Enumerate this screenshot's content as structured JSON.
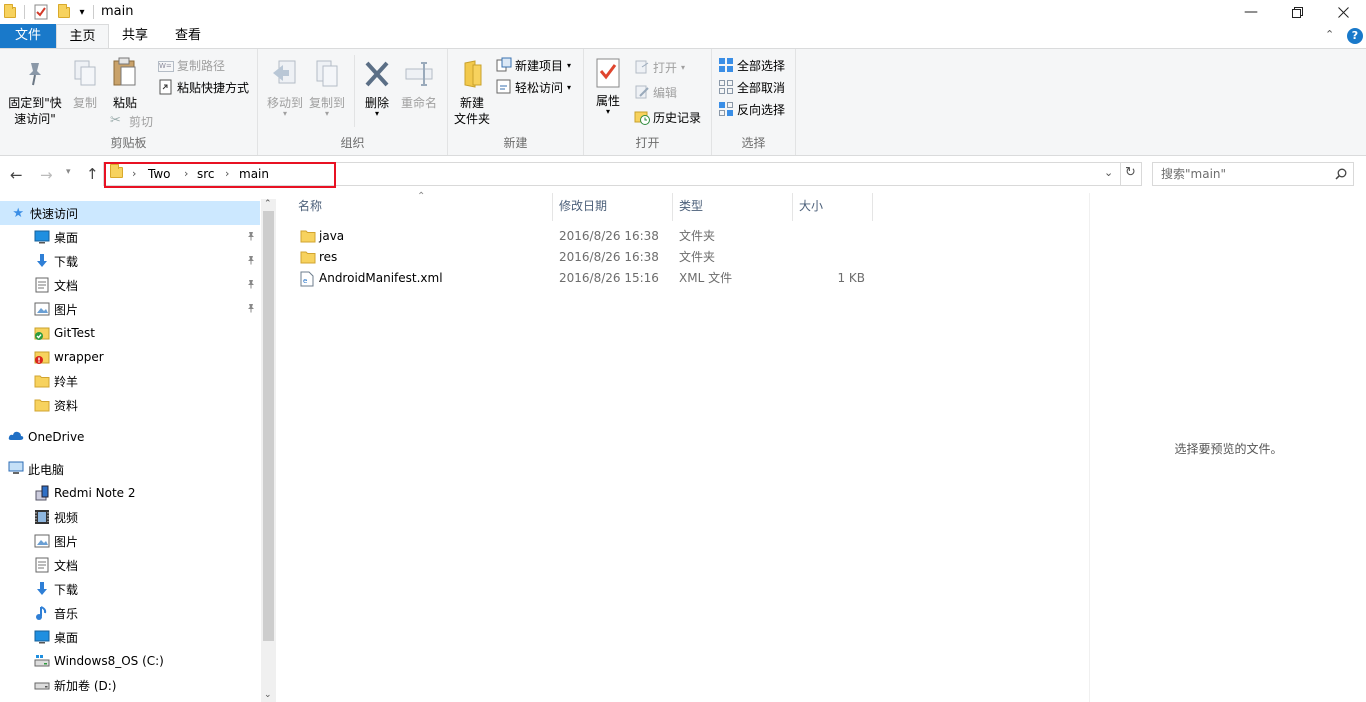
{
  "window": {
    "title": "main",
    "minimize_icon": "minimize-icon",
    "maximize_icon": "restore-icon",
    "close_icon": "close-icon"
  },
  "tabs": [
    "文件",
    "主页",
    "共享",
    "查看"
  ],
  "ribbon": {
    "clipboard": {
      "label": "剪贴板",
      "pin_quick_access": "固定到\"快速访问\"",
      "pin_line1": "固定到\"快",
      "pin_line2": "速访问\"",
      "copy": "复制",
      "paste": "粘贴",
      "copy_path": "复制路径",
      "paste_shortcut": "粘贴快捷方式",
      "cut": "剪切"
    },
    "organize": {
      "label": "组织",
      "move_to": "移动到",
      "copy_to": "复制到",
      "delete": "删除",
      "rename": "重命名"
    },
    "new": {
      "label": "新建",
      "new_folder_1": "新建",
      "new_folder_2": "文件夹",
      "new_item": "新建项目",
      "easy_access": "轻松访问"
    },
    "open": {
      "label": "打开",
      "properties": "属性",
      "open": "打开",
      "edit": "编辑",
      "history": "历史记录"
    },
    "select": {
      "label": "选择",
      "select_all": "全部选择",
      "select_none": "全部取消",
      "invert": "反向选择"
    }
  },
  "breadcrumb": [
    "Two",
    "src",
    "main"
  ],
  "search_placeholder": "搜索\"main\"",
  "sidebar": {
    "quick_access": "快速访问",
    "quick_items": [
      {
        "label": "桌面",
        "icon": "desktop-icon",
        "pinned": true
      },
      {
        "label": "下载",
        "icon": "download-icon",
        "pinned": true
      },
      {
        "label": "文档",
        "icon": "documents-icon",
        "pinned": true
      },
      {
        "label": "图片",
        "icon": "pictures-icon",
        "pinned": true
      },
      {
        "label": "GitTest",
        "icon": "git-folder-icon",
        "pinned": false
      },
      {
        "label": "wrapper",
        "icon": "git-conflict-folder-icon",
        "pinned": false
      },
      {
        "label": "羚羊",
        "icon": "folder-icon",
        "pinned": false
      },
      {
        "label": "资料",
        "icon": "folder-icon",
        "pinned": false
      }
    ],
    "onedrive": "OneDrive",
    "this_pc": "此电脑",
    "pc_items": [
      {
        "label": "Redmi Note 2",
        "icon": "phone-icon"
      },
      {
        "label": "视频",
        "icon": "videos-icon"
      },
      {
        "label": "图片",
        "icon": "pictures-icon"
      },
      {
        "label": "文档",
        "icon": "documents-icon"
      },
      {
        "label": "下载",
        "icon": "download-icon"
      },
      {
        "label": "音乐",
        "icon": "music-icon"
      },
      {
        "label": "桌面",
        "icon": "desktop-icon"
      },
      {
        "label": "Windows8_OS (C:)",
        "icon": "system-drive-icon"
      },
      {
        "label": "新加卷 (D:)",
        "icon": "drive-icon"
      }
    ]
  },
  "columns": [
    "名称",
    "修改日期",
    "类型",
    "大小"
  ],
  "files": [
    {
      "name": "java",
      "date": "2016/8/26 16:38",
      "type": "文件夹",
      "size": "",
      "icon": "folder-icon"
    },
    {
      "name": "res",
      "date": "2016/8/26 16:38",
      "type": "文件夹",
      "size": "",
      "icon": "folder-icon"
    },
    {
      "name": "AndroidManifest.xml",
      "date": "2016/8/26 15:16",
      "type": "XML 文件",
      "size": "1 KB",
      "icon": "xml-file-icon"
    }
  ],
  "preview_text": "选择要预览的文件。",
  "colors": {
    "accent": "#1979ca",
    "selection": "#cce8ff",
    "highlight_box": "#e81123"
  }
}
